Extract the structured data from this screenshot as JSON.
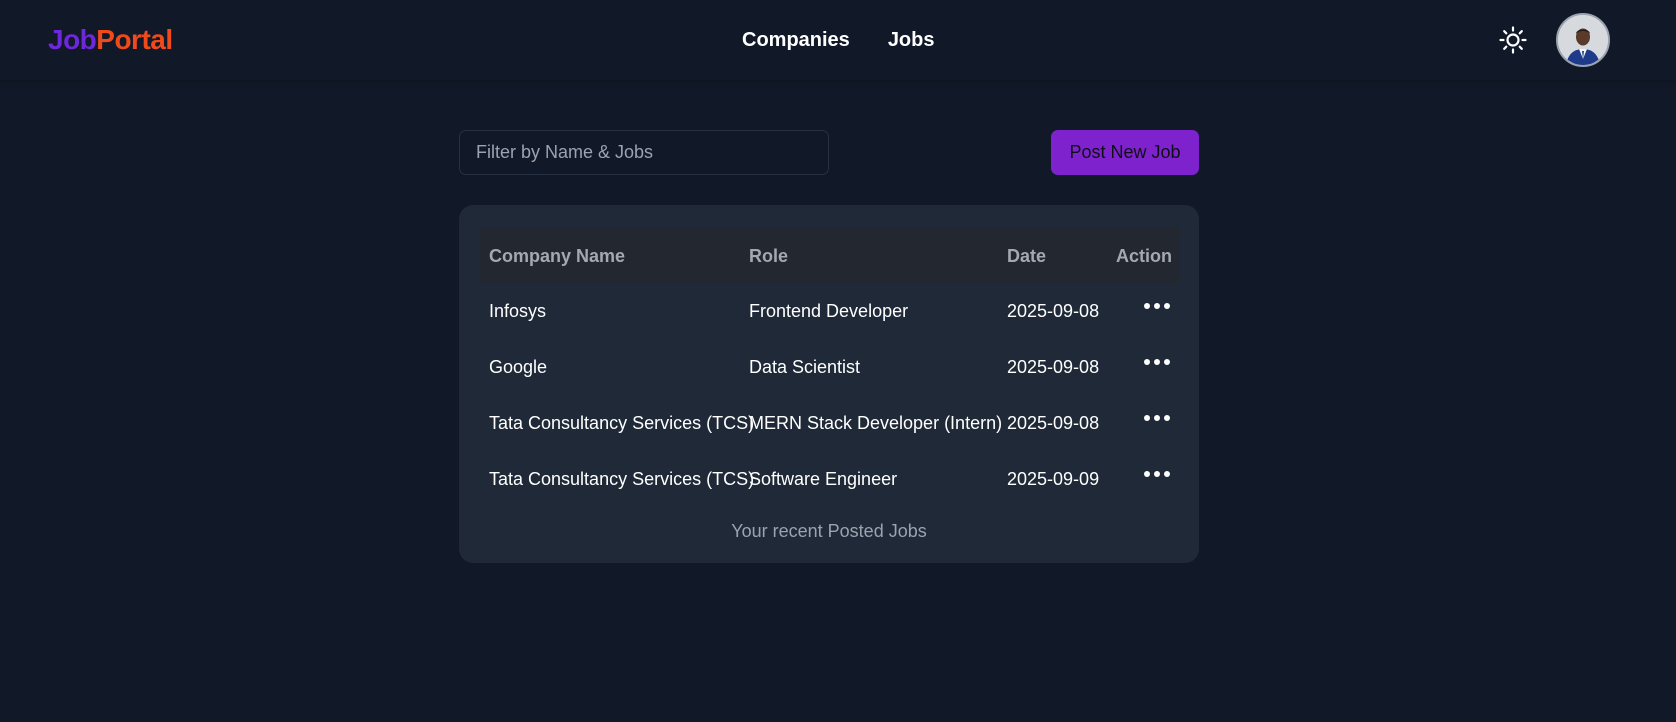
{
  "navbar": {
    "logo_part1": "Job",
    "logo_part2": "Portal",
    "links": [
      "Companies",
      "Jobs"
    ],
    "theme_icon": "sun-icon",
    "avatar_icon": "user-avatar"
  },
  "toolbar": {
    "filter_placeholder": "Filter by Name & Jobs",
    "filter_value": "",
    "post_button": "Post New Job"
  },
  "table": {
    "headers": [
      "Company Name",
      "Role",
      "Date",
      "Action"
    ],
    "rows": [
      {
        "company": "Infosys",
        "role": "Frontend Developer",
        "date": "2025-09-08",
        "action_icon": "more-horizontal-icon"
      },
      {
        "company": "Google",
        "role": "Data Scientist",
        "date": "2025-09-08",
        "action_icon": "more-horizontal-icon"
      },
      {
        "company": "Tata Consultancy Services (TCS)",
        "role": "MERN Stack Developer (Intern)",
        "date": "2025-09-08",
        "action_icon": "more-horizontal-icon"
      },
      {
        "company": "Tata Consultancy Services (TCS)",
        "role": "Software Engineer",
        "date": "2025-09-09",
        "action_icon": "more-horizontal-icon"
      }
    ],
    "caption": "Your recent Posted Jobs"
  },
  "colors": {
    "background": "#111827",
    "card": "#1f2937",
    "accent": "#7e22ce",
    "logo_primary": "#6d28d9",
    "logo_secondary": "#f04a1a"
  }
}
